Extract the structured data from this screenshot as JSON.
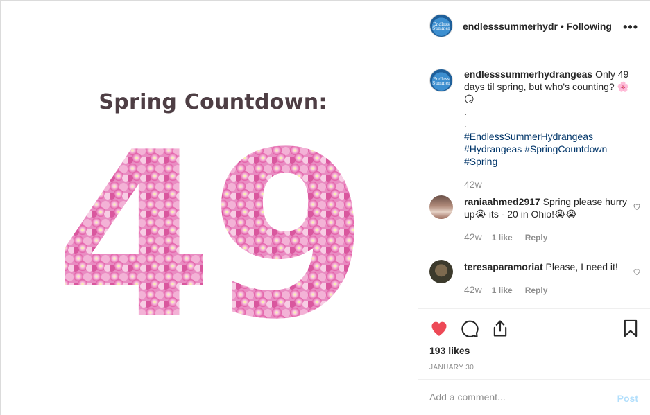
{
  "post": {
    "image": {
      "heading": "Spring Countdown:",
      "number": "49"
    }
  },
  "header": {
    "username": "endlesssummerhydr",
    "separator": "•",
    "follow_status": "Following",
    "avatar_text": "Endless Summer",
    "more_icon": "more-options-icon"
  },
  "caption": {
    "username": "endlesssummerhydrangeas",
    "text": "Only 49 days til spring, but who's counting? 🌸😏",
    "dot1": ".",
    "dot2": ".",
    "hashtags": [
      "#EndlessSummerHydrangeas",
      "#Hydrangeas #SpringCountdown",
      "#Spring"
    ],
    "age": "42w"
  },
  "comments": [
    {
      "username": "raniaahmed2917",
      "text": "Spring please hurry up😭 its - 20 in Ohio!😭😭",
      "age": "42w",
      "likes": "1 like",
      "reply": "Reply"
    },
    {
      "username": "teresaparamoriat",
      "text": "Please, I need it!",
      "age": "42w",
      "likes": "1 like",
      "reply": "Reply"
    }
  ],
  "actions": {
    "like_icon": "heart-filled-icon",
    "comment_icon": "comment-icon",
    "share_icon": "share-icon",
    "save_icon": "bookmark-icon",
    "like_color": "#ed4956",
    "likes": "193 likes",
    "date": "JANUARY 30"
  },
  "composer": {
    "placeholder": "Add a comment...",
    "post_label": "Post"
  }
}
